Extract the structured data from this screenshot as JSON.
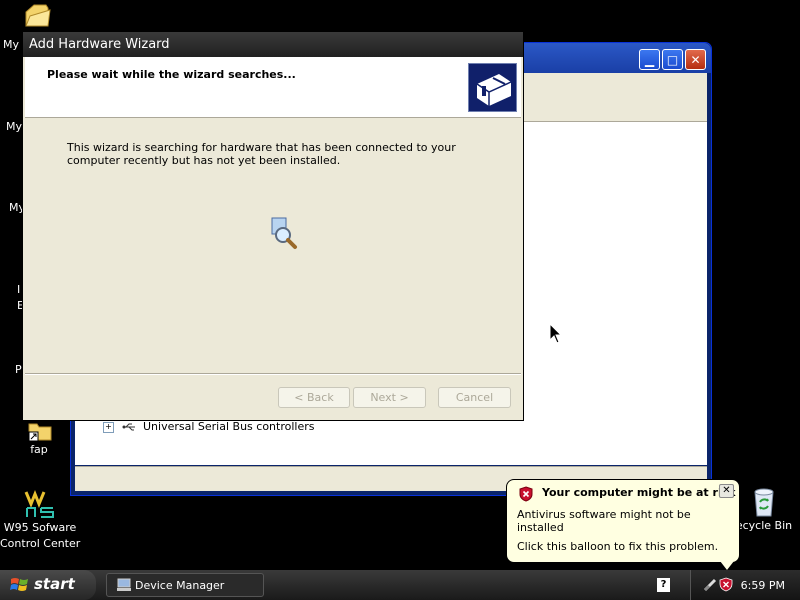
{
  "desktop": {
    "icons": [
      {
        "label": "My I"
      },
      {
        "label": "My"
      },
      {
        "label": "My"
      },
      {
        "label": "I\nE"
      },
      {
        "label": "P"
      },
      {
        "label": "fap"
      },
      {
        "label": "W95 Sofware\nControl Center"
      },
      {
        "label": "ecycle Bin"
      }
    ]
  },
  "device_manager": {
    "tree_item": "Universal Serial Bus controllers",
    "title_buttons": {
      "minimize": "▁",
      "maximize": "□",
      "close": "✕"
    }
  },
  "wizard": {
    "title": "Add Hardware Wizard",
    "heading": "Please wait while the wizard searches...",
    "body": "This wizard is searching for hardware that has been connected to your computer recently but has not yet been installed.",
    "buttons": {
      "back": "< Back",
      "next": "Next >",
      "cancel": "Cancel"
    }
  },
  "balloon": {
    "title": "Your computer might be at risk",
    "line1": "Antivirus software might not be installed",
    "line2": "Click this balloon to fix this problem.",
    "close": "✕"
  },
  "taskbar": {
    "start_label": "start",
    "task_item": "Device Manager",
    "clock": "6:59 PM",
    "help": "?"
  },
  "colors": {
    "balloon_bg": "#ffffe1",
    "shield_red": "#c8102e",
    "taskbar_dark": "#1a1a1a"
  }
}
